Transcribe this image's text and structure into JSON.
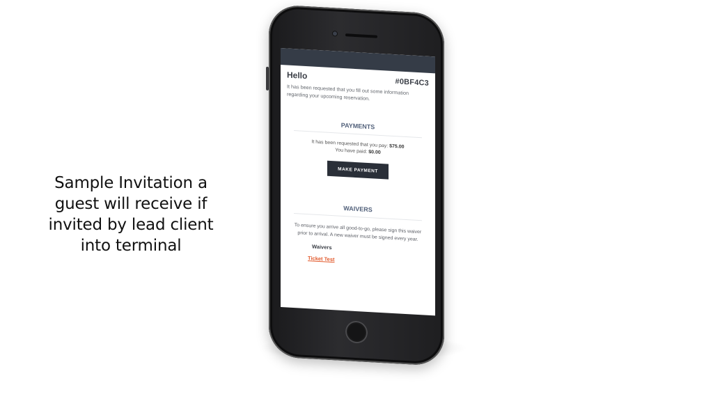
{
  "caption": {
    "line1": "Sample Invitation a",
    "line2": "guest will receive if",
    "line3": "invited by lead client",
    "line4": "into terminal"
  },
  "email": {
    "greeting": "Hello",
    "reservation_code": "#0BF4C3",
    "intro": "It has been requested that you fill out some information regarding your upcoming reservation.",
    "payments": {
      "title": "PAYMENTS",
      "requested_label": "It has been requested that you pay:",
      "requested_amount": "$75.00",
      "paid_label": "You have paid:",
      "paid_amount": "$0.00",
      "button_label": "MAKE PAYMENT"
    },
    "waivers": {
      "title": "WAIVERS",
      "description": "To ensure you arrive all good-to-go, please sign this waiver prior to arrival. A new waiver must be signed every year.",
      "list_label": "Waivers",
      "items": [
        {
          "label": "Ticket Test"
        }
      ]
    }
  },
  "colors": {
    "header_bar": "#353c47",
    "button_bg": "#2a2f38",
    "link": "#e2592b",
    "section_title": "#51607a"
  }
}
